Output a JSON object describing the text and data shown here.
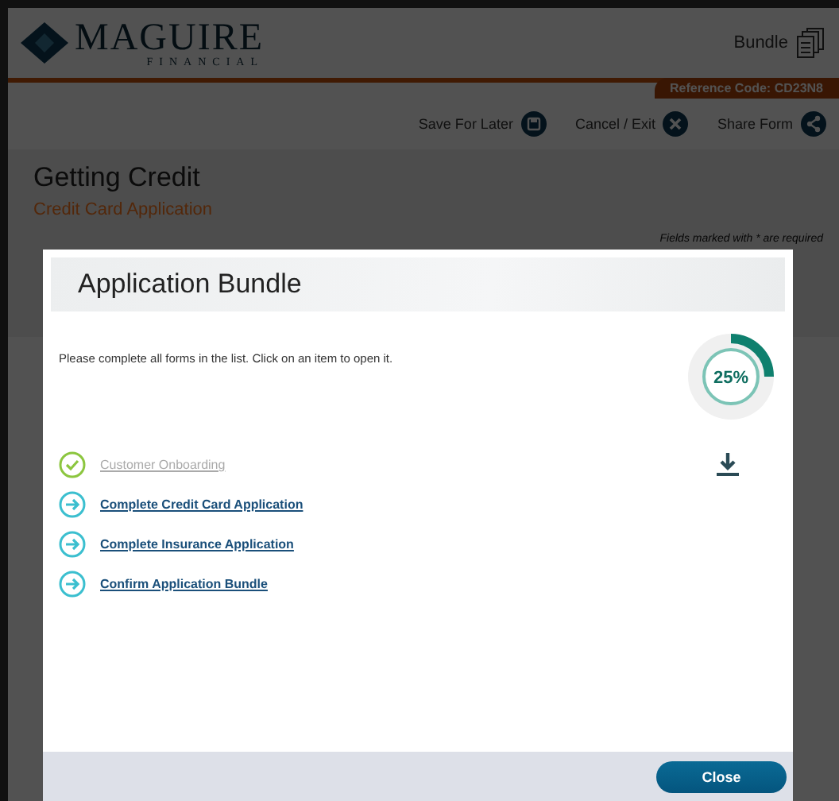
{
  "header": {
    "brand": "MAGUIRE",
    "brand_sub": "FINANCIAL",
    "bundle_label": "Bundle",
    "reference": "Reference Code: CD23N8"
  },
  "toolbar": [
    {
      "label": "Save For Later",
      "kind": "save"
    },
    {
      "label": "Cancel / Exit",
      "kind": "cancel"
    },
    {
      "label": "Share Form",
      "kind": "share"
    }
  ],
  "page": {
    "title": "Getting Credit",
    "subtitle": "Credit Card Application",
    "required_note": "Fields marked with * are required"
  },
  "dialog": {
    "title": "Application Bundle",
    "instructions": "Please complete all forms in the list. Click on an item to open it.",
    "progress": {
      "level": 0.25,
      "reading": "25%"
    },
    "items": [
      {
        "label": "Customer Onboarding",
        "completed": true
      },
      {
        "label": "Complete Credit Card Application",
        "completed": false
      },
      {
        "label": "Complete Insurance Application",
        "completed": false
      },
      {
        "label": "Confirm Application Bundle",
        "completed": false
      }
    ],
    "close_button": "Close"
  }
}
